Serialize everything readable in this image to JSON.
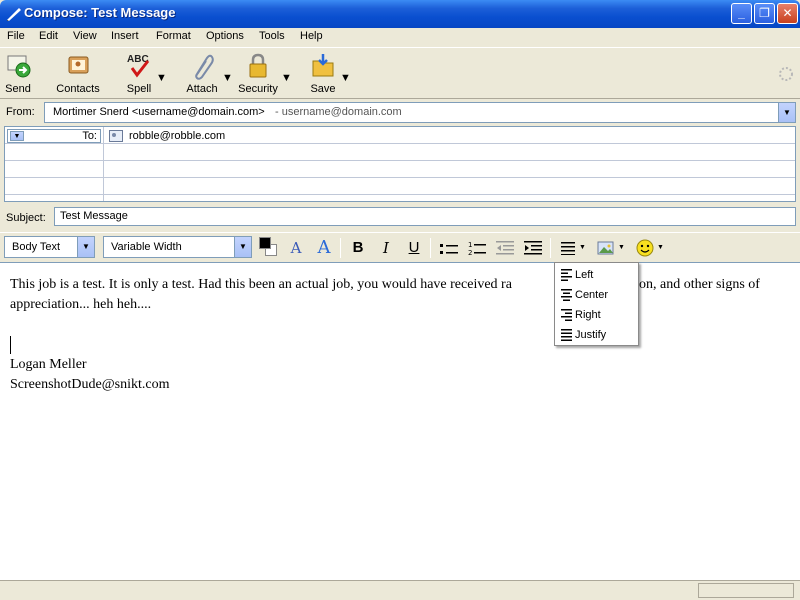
{
  "window": {
    "title": "Compose: Test Message",
    "controls": {
      "minimize": "_",
      "restore": "❐",
      "close": "✕"
    }
  },
  "menu": [
    "File",
    "Edit",
    "View",
    "Insert",
    "Format",
    "Options",
    "Tools",
    "Help"
  ],
  "toolbar": {
    "send": "Send",
    "contacts": "Contacts",
    "spell": "Spell",
    "spell_icon_text": "ABC",
    "attach": "Attach",
    "security": "Security",
    "save": "Save"
  },
  "address": {
    "from_label": "From:",
    "from_name": "Mortimer Snerd <username@domain.com>",
    "from_account": "- username@domain.com",
    "to_type": "To:",
    "to_value": "robble@robble.com"
  },
  "subject": {
    "label": "Subject:",
    "value": "Test Message"
  },
  "format": {
    "paragraph_style": "Body Text",
    "font": "Variable Width",
    "bold": "B",
    "italic": "I",
    "underline": "U"
  },
  "body": {
    "line1": "This job is a test.  It is only a test.  Had this been an actual job, you would have received ra",
    "line1_end": "on, and other signs of",
    "line2": "appreciation... heh heh....",
    "sig_name": "Logan Meller",
    "sig_email": "ScreenshotDude@snikt.com"
  },
  "align_menu": [
    "Left",
    "Center",
    "Right",
    "Justify"
  ],
  "colors": {
    "titlebar": "#0a4fd0",
    "text_color_swatch": "#000000"
  }
}
